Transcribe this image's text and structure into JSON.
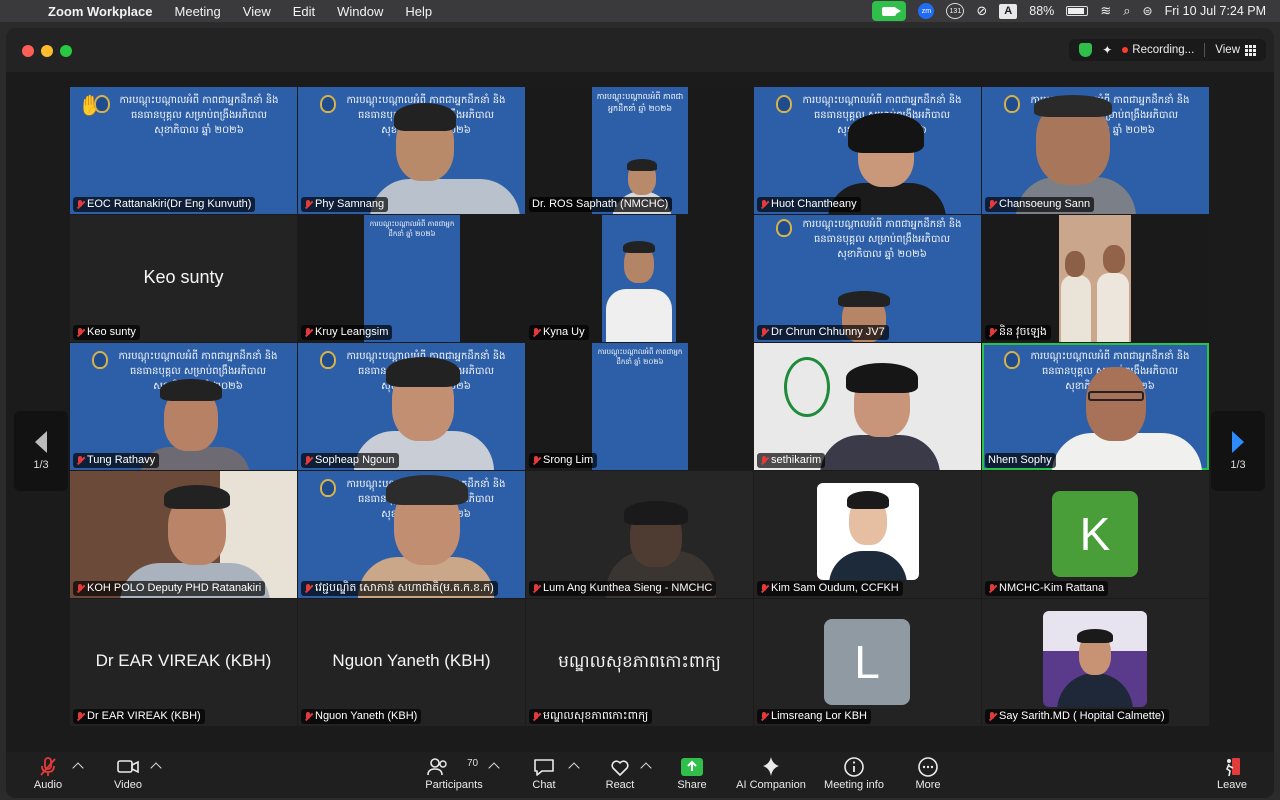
{
  "menubar": {
    "app": "Zoom Workplace",
    "menus": [
      "Meeting",
      "View",
      "Edit",
      "Window",
      "Help"
    ],
    "battery": "88%",
    "badge": "131",
    "input_source": "A",
    "datetime": "Fri 10 Jul  7:24 PM"
  },
  "titlebar": {
    "recording": "Recording...",
    "view": "View"
  },
  "nav": {
    "page_left": "1/3",
    "page_right": "1/3"
  },
  "banner": "ការបណ្តុះបណ្តាលអំពី ភាពជាអ្នកដឹកនាំ និងធនធានបុគ្គល សម្រាប់ពង្រឹងអភិបាលសុខាភិបាល ឆ្នាំ ២០២៦",
  "tiles": [
    {
      "name": "EOC Rattanakiri(Dr Eng Kunvuth)"
    },
    {
      "name": "Phy Samnang"
    },
    {
      "name": "Dr. ROS Saphath (NMCHC)"
    },
    {
      "name": "Huot Chantheany"
    },
    {
      "name": "Chansoeung Sann"
    },
    {
      "name": "Keo sunty",
      "display": "Keo sunty"
    },
    {
      "name": "Kruy Leangsim"
    },
    {
      "name": "Kyna Uy"
    },
    {
      "name": "Dr Chrun Chhunny JV7"
    },
    {
      "name": "និន វុចឡេង"
    },
    {
      "name": "Tung Rathavy"
    },
    {
      "name": "Sopheap Ngoun"
    },
    {
      "name": "Srong Lim"
    },
    {
      "name": "sethikarim"
    },
    {
      "name": "Nhem Sophy"
    },
    {
      "name": "KOH POLO Deputy PHD Ratanakiri"
    },
    {
      "name": "វេជ្ជបណ្ឌិត សោភាន់ សហាជាតិ(ម.ត.ក.ខ.ក)"
    },
    {
      "name": "Lum Ang Kunthea Sieng - NMCHC"
    },
    {
      "name": "Kim Sam Oudum, CCFKH"
    },
    {
      "name": "NMCHC-Kim Rattana",
      "avatar": "K"
    },
    {
      "name": "Dr EAR VIREAK (KBH)",
      "display": "Dr EAR VIREAK (KBH)"
    },
    {
      "name": "Nguon Yaneth (KBH)",
      "display": "Nguon Yaneth (KBH)"
    },
    {
      "name": "មណ្ឌលសុខភាពកោះពាក្យ",
      "display": "មណ្ឌលសុខភាពកោះពាក្យ"
    },
    {
      "name": "Limsreang Lor KBH",
      "avatar": "L"
    },
    {
      "name": "Say Sarith.MD ( Hopital Calmette)"
    }
  ],
  "toolbar": {
    "audio": "Audio",
    "video": "Video",
    "participants": "Participants",
    "participants_count": "70",
    "chat": "Chat",
    "react": "React",
    "share": "Share",
    "ai": "AI Companion",
    "info": "Meeting info",
    "more": "More",
    "leave": "Leave"
  },
  "colors": {
    "banner_blue": "#2d5fa8",
    "active_border": "#29c34a",
    "share_green": "#2fbf4a",
    "avatar_green": "#4a9e3a",
    "avatar_gray": "#8f9aa3"
  }
}
